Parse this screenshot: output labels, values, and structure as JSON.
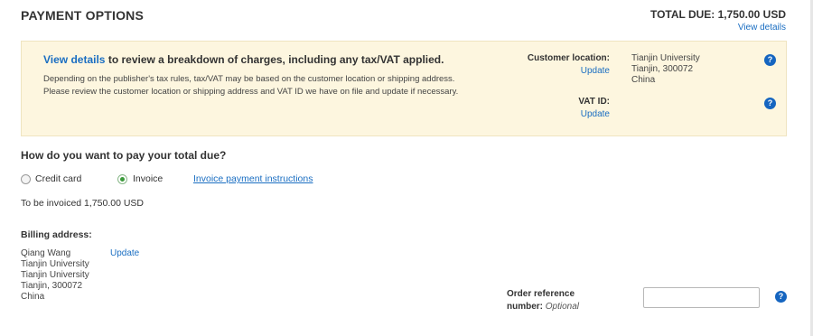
{
  "header": {
    "title": "PAYMENT OPTIONS",
    "total_due": "TOTAL DUE: 1,750.00 USD",
    "view_details": "View details"
  },
  "info_box": {
    "heading_link": "View details",
    "heading_rest": " to review a breakdown of charges, including any tax/VAT applied.",
    "body": "Depending on the publisher's tax rules, tax/VAT may be based on the customer location or shipping address. Please review the customer location or shipping address and VAT ID we have on file and update if necessary.",
    "customer_location_label": "Customer location:",
    "customer_location_update": "Update",
    "customer_location_lines": [
      "Tianjin University",
      "Tianjin, 300072",
      "China"
    ],
    "vat_label": "VAT ID:",
    "vat_update": "Update",
    "help_glyph": "?"
  },
  "payment": {
    "question": "How do you want to pay your total due?",
    "options": [
      {
        "label": "Credit card",
        "selected": false
      },
      {
        "label": "Invoice",
        "selected": true
      }
    ],
    "instructions_link": "Invoice payment instructions",
    "invoiced_text": "To be invoiced 1,750.00 USD"
  },
  "billing": {
    "label": "Billing address:",
    "lines": [
      "Qiang Wang",
      "Tianjin University",
      "Tianjin University",
      "Tianjin, 300072",
      "China"
    ],
    "update": "Update"
  },
  "order_reference": {
    "label_bold": "Order reference",
    "label_bold2": "number:",
    "label_optional": "Optional",
    "value": "",
    "help_glyph": "?"
  },
  "colors": {
    "link": "#1a6ec2",
    "info_bg": "#fdf6df",
    "help_icon": "#1565c0",
    "radio_selected": "#3c9a3c"
  }
}
